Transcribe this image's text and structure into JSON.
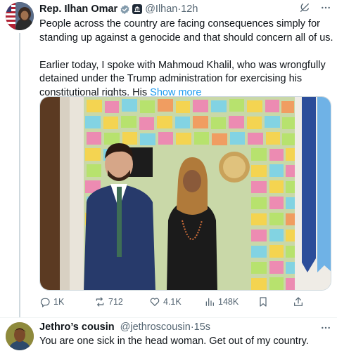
{
  "tweet": {
    "name": "Rep. Ilhan Omar",
    "handle": "@Ilhan",
    "separator": "·",
    "time": "12h",
    "paragraph1": "People across the country are facing consequences simply for standing up against a genocide and that should concern all of us.",
    "paragraph2": "Earlier today, I spoke with Mahmoud Khalil, who was wrongfully detained under the Trump administration for exercising his constitutional rights. His",
    "show_more": "Show more",
    "actions": {
      "replies": "1K",
      "reposts": "712",
      "likes": "4.1K",
      "views": "148K"
    }
  },
  "reply": {
    "name": "Jethro’s cousin",
    "handle": "@jethroscousin",
    "separator": "·",
    "time": "15s",
    "text": "You are one sick in the head woman. Get out of my country."
  },
  "colors": {
    "accent": "#1d9bf0",
    "muted": "#536471",
    "text": "#0f1419"
  },
  "icons": [
    "verified-badge-icon",
    "government-badge-icon",
    "grok-icon",
    "more-icon",
    "reply-icon",
    "repost-icon",
    "like-icon",
    "views-icon",
    "bookmark-icon",
    "share-icon"
  ]
}
